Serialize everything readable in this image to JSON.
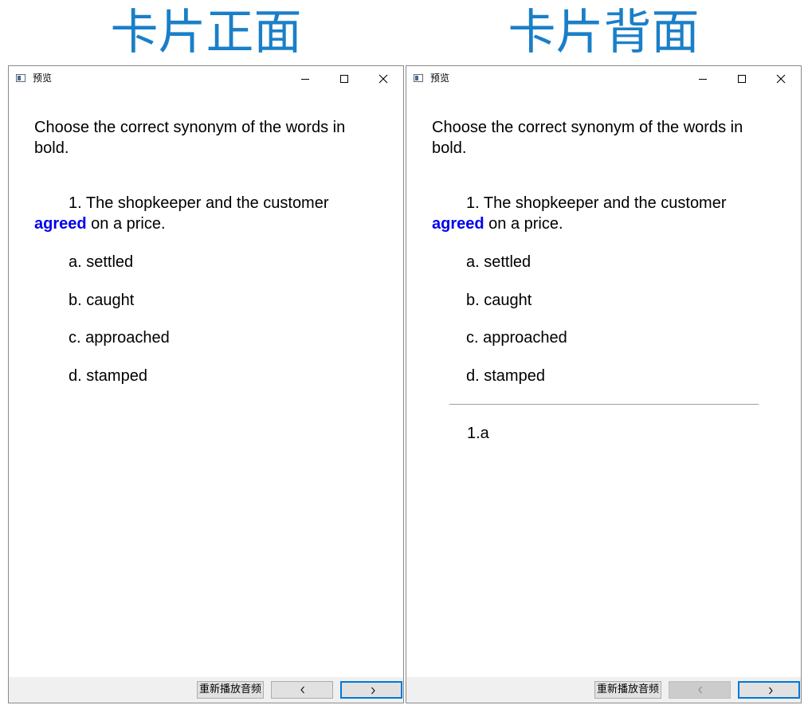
{
  "headings": {
    "front": "卡片正面",
    "back": "卡片背面"
  },
  "colors": {
    "heading": "#1a7fc8",
    "keyword": "#0000ee",
    "focus_border": "#0078d7"
  },
  "window": {
    "title": "预览",
    "icons": [
      "app-icon",
      "minimize-icon",
      "maximize-icon",
      "close-icon"
    ]
  },
  "card": {
    "instruction": "Choose the correct synonym of the words in bold.",
    "question_prefix": "1. The shopkeeper and the customer ",
    "question_keyword": "agreed",
    "question_suffix": " on a price.",
    "options": [
      "a. settled",
      "b. caught",
      "c. approached",
      "d. stamped"
    ],
    "answer": "1.a"
  },
  "bottombar": {
    "replay_label": "重新播放音频",
    "prev_icon": "chevron-left-icon",
    "next_icon": "chevron-right-icon"
  }
}
